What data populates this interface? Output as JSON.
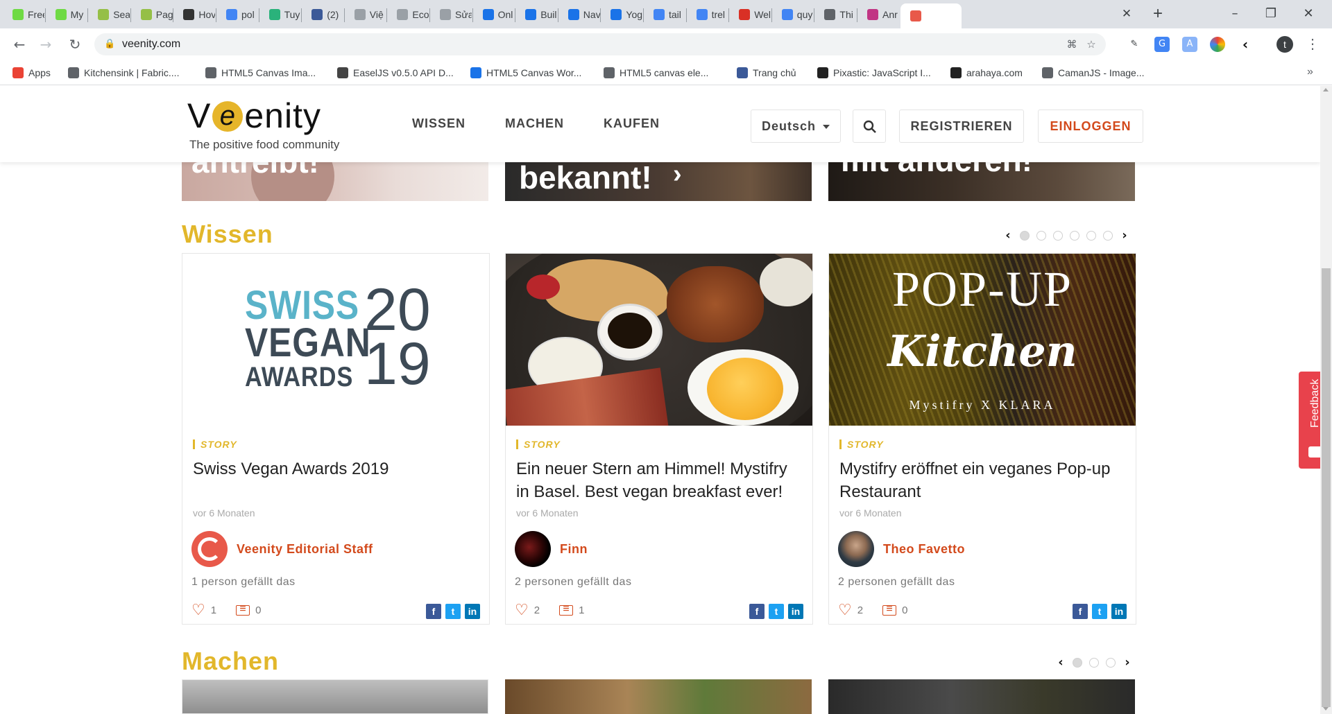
{
  "browser": {
    "tabs": [
      {
        "label": "Free",
        "icon": "upwork-icon",
        "color": "#6fda44"
      },
      {
        "label": "My",
        "icon": "upwork-icon",
        "color": "#6fda44"
      },
      {
        "label": "Sea",
        "icon": "shopify-icon",
        "color": "#95bf47"
      },
      {
        "label": "Pag",
        "icon": "shopify-icon",
        "color": "#95bf47"
      },
      {
        "label": "Hov",
        "icon": "boot-icon",
        "color": "#333333"
      },
      {
        "label": "pol",
        "icon": "google-icon",
        "color": "#4285f4"
      },
      {
        "label": "Tuy",
        "icon": "tuyen-icon",
        "color": "#2ab27b"
      },
      {
        "label": "(2)",
        "icon": "facebook-icon",
        "color": "#3b5998"
      },
      {
        "label": "Việ",
        "icon": "page-icon",
        "color": "#9aa0a6"
      },
      {
        "label": "Eco",
        "icon": "page-icon",
        "color": "#9aa0a6"
      },
      {
        "label": "Sửa",
        "icon": "page-icon",
        "color": "#9aa0a6"
      },
      {
        "label": "Onl",
        "icon": "yoast-icon",
        "color": "#1a73e8"
      },
      {
        "label": "Buil",
        "icon": "yoast-icon",
        "color": "#1a73e8"
      },
      {
        "label": "Nav",
        "icon": "yoast-icon",
        "color": "#1a73e8"
      },
      {
        "label": "Yog",
        "icon": "yoast-icon",
        "color": "#1a73e8"
      },
      {
        "label": "tail",
        "icon": "google-icon",
        "color": "#4285f4"
      },
      {
        "label": "trel",
        "icon": "google-icon",
        "color": "#4285f4"
      },
      {
        "label": "Wel",
        "icon": "gmail-icon",
        "color": "#d93025"
      },
      {
        "label": "quy",
        "icon": "google-icon",
        "color": "#4285f4"
      },
      {
        "label": "Thi",
        "icon": "globe-icon",
        "color": "#5f6368"
      },
      {
        "label": "Anr",
        "icon": "instagram-icon",
        "color": "#c13584"
      },
      {
        "label": "",
        "icon": "veenity-icon",
        "color": "#e8594a"
      }
    ],
    "url": "veenity.com",
    "bookmarks": [
      {
        "label": "Apps",
        "icon": "apps-grid-icon",
        "color": "#ea4335"
      },
      {
        "label": "Kitchensink | Fabric....",
        "icon": "globe-icon",
        "color": "#5f6368"
      },
      {
        "label": "HTML5 Canvas Ima...",
        "icon": "globe-icon",
        "color": "#5f6368"
      },
      {
        "label": "EaselJS v0.5.0 API D...",
        "icon": "cube-icon",
        "color": "#444444"
      },
      {
        "label": "HTML5 Canvas Wor...",
        "icon": "html5-icon",
        "color": "#1a73e8"
      },
      {
        "label": "HTML5 canvas ele...",
        "icon": "globe-icon",
        "color": "#5f6368"
      },
      {
        "label": "Trang chủ",
        "icon": "facebook-icon",
        "color": "#3b5998"
      },
      {
        "label": "Pixastic: JavaScript I...",
        "icon": "pixastic-icon",
        "color": "#222222"
      },
      {
        "label": "arahaya.com",
        "icon": "arahaya-icon",
        "color": "#222222"
      },
      {
        "label": "CamanJS - Image...",
        "icon": "globe-icon",
        "color": "#5f6368"
      }
    ]
  },
  "site": {
    "logo_prefix": "V",
    "logo_e": "e",
    "logo_suffix": "enity",
    "tagline": "The positive food community",
    "nav": [
      "WISSEN",
      "MACHEN",
      "KAUFEN"
    ],
    "language": "Deutsch",
    "register": "REGISTRIEREN",
    "login": "EINLOGGEN",
    "hero": [
      "antreibt!",
      "bekannt!",
      "mit anderen!"
    ],
    "accent": "#e2b72b",
    "brand_red": "#d34a1c",
    "feedback_label": "Feedback"
  },
  "wissen": {
    "title": "Wissen",
    "dots": 6,
    "active_dot": 1,
    "cards": [
      {
        "category": "STORY",
        "title": "Swiss Vegan Awards 2019",
        "date": "vor 6 Monaten",
        "author": "Veenity Editorial Staff",
        "likes_text": "1 person gefällt das",
        "likes": "1",
        "comments": "0",
        "image_lines": [
          "SWISS",
          "VEGAN",
          "AWARDS",
          "20",
          "19"
        ]
      },
      {
        "category": "STORY",
        "title": "Ein neuer Stern am Himmel! Mystifry in Basel. Best vegan breakfast ever!",
        "date": "vor 6 Monaten",
        "author": "Finn",
        "likes_text": "2 personen gefällt das",
        "likes": "2",
        "comments": "1"
      },
      {
        "category": "STORY",
        "title": "Mystifry eröffnet ein veganes Pop-up Restaurant",
        "date": "vor 6 Monaten",
        "author": "Theo Favetto",
        "likes_text": "2 personen gefällt das",
        "likes": "2",
        "comments": "0",
        "image_lines": [
          "POP-UP",
          "Kitchen",
          "Mystifry X KLARA"
        ]
      }
    ]
  },
  "machen": {
    "title": "Machen",
    "dots": 3,
    "active_dot": 1
  }
}
